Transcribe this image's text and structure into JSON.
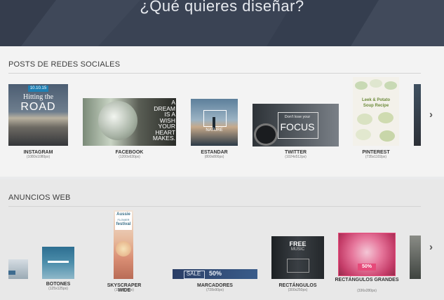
{
  "hero": {
    "title": "¿Qué quieres diseñar?"
  },
  "social": {
    "title": "POSTS DE REDES SOCIALES",
    "items": [
      {
        "label": "INSTAGRAM",
        "size": "(1080x1080px)",
        "thumb_date": "10.10.15",
        "thumb_line1": "Hitting the",
        "thumb_line2": "ROAD"
      },
      {
        "label": "FACEBOOK",
        "size": "(1200x630px)",
        "thumb_lines": [
          "A",
          "DREAM",
          "IS A",
          "WISH",
          "YOUR",
          "HEART",
          "MAKES."
        ]
      },
      {
        "label": "ESTANDAR",
        "size": "(800x800px)",
        "thumb_line1": "NATURE"
      },
      {
        "label": "TWITTER",
        "size": "(1024x512px)",
        "thumb_line1": "Don't lose your",
        "thumb_line2": "FOCUS"
      },
      {
        "label": "PINTEREST",
        "size": "(735x1102px)",
        "thumb_line1": "Leek & Potato",
        "thumb_line2": "Soup Recipe"
      }
    ]
  },
  "web": {
    "title": "ANUNCIOS WEB",
    "items": [
      {
        "label": "BOTONES",
        "size": "(125x125px)"
      },
      {
        "label": "SKYSCRAPER WIDE",
        "size": "(120x600px)",
        "thumb_line1": "Aussie",
        "thumb_line2": "FLOWER",
        "thumb_line3": "festival"
      },
      {
        "label": "MARCADORES",
        "size": "(728x90px)",
        "thumb_line1": "SALE",
        "thumb_line2": "50%"
      },
      {
        "label": "RECTÁNGULOS",
        "size": "(300x250px)",
        "thumb_line1": "FREE",
        "thumb_line2": "MUSIC"
      },
      {
        "label": "RECTÁNGULOS GRANDES",
        "size": "(336x280px)",
        "thumb_line1": "50%"
      }
    ]
  },
  "colors": {
    "hero_bg": "#3a4354",
    "section_bg": "#f3f3f3",
    "accent_pink": "#e64a7a"
  },
  "icons": {
    "next": "chevron-right-icon"
  }
}
